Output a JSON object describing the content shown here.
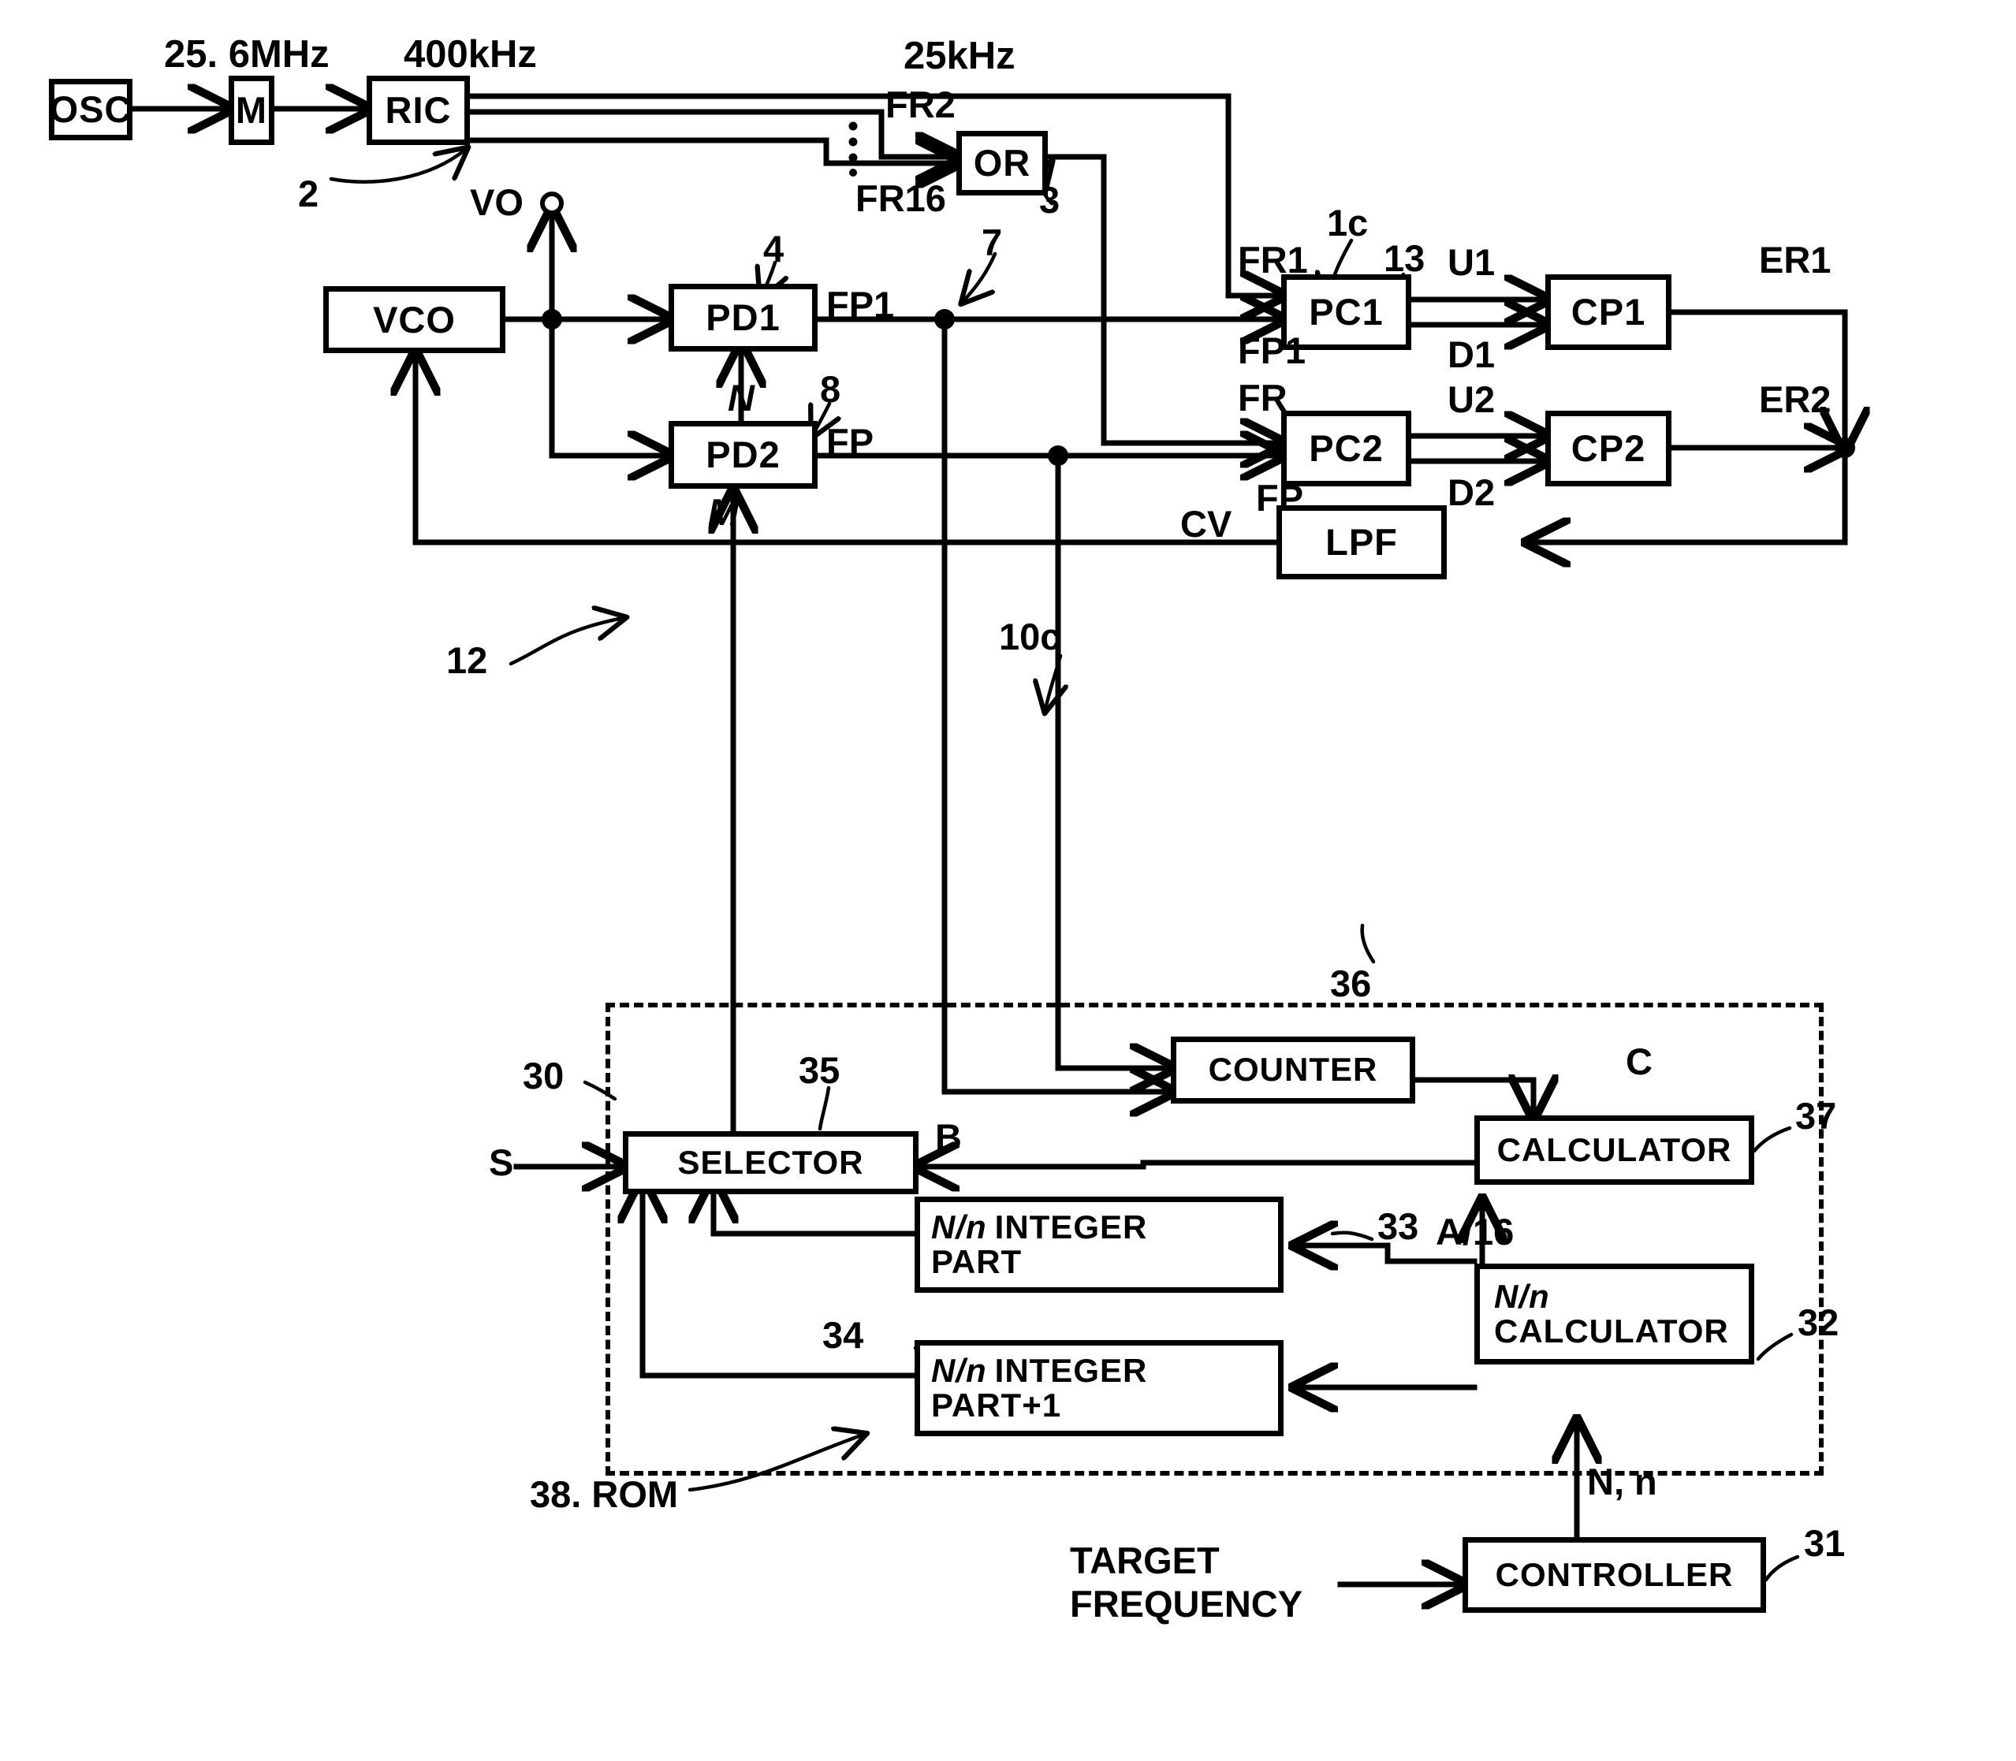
{
  "figure": {
    "type": "patent-block-diagram",
    "description": "PLL frequency synthesizer block diagram"
  },
  "blocks": {
    "osc": "OSC",
    "m_divider": "M",
    "ric": "RIC",
    "or_gate": "OR",
    "vco": "VCO",
    "pd1": "PD1",
    "pd2": "PD2",
    "pc1": "PC1",
    "pc2": "PC2",
    "cp1": "CP1",
    "cp2": "CP2",
    "lpf": "LPF",
    "counter": "COUNTER",
    "selector": "SELECTOR",
    "calculator": "CALCULATOR",
    "nn_calculator_l1": "N/n",
    "nn_calculator_l2": "CALCULATOR",
    "rom33_l1": "N/n",
    "rom33_l2": "INTEGER",
    "rom33_l3": "PART",
    "rom34_l1": "N/n",
    "rom34_l2": "INTEGER",
    "rom34_l3": "PART+1",
    "controller": "CONTROLLER"
  },
  "signal_labels": {
    "freq_25_6mhz": "25. 6MHz",
    "freq_400khz": "400kHz",
    "freq_25khz": "25kHz",
    "fr2": "FR2",
    "fr16": "FR16",
    "vo": "VO",
    "fp1_out": "FP1",
    "fp_out": "FP",
    "fr1": "FR1",
    "fp1_in": "FP1",
    "u1": "U1",
    "d1": "D1",
    "er1": "ER1",
    "fr": "FR",
    "fp": "FP",
    "u2": "U2",
    "d2": "D2",
    "er2": "ER2",
    "cv": "CV",
    "n_div": "N",
    "m_div": "M",
    "s_input": "S",
    "b_signal": "B",
    "c_signal": "C",
    "a_over_16": "A/16",
    "n_comma_n": "N, n",
    "target_frequency_l1": "TARGET",
    "target_frequency_l2": "FREQUENCY"
  },
  "reference_numbers": {
    "ref_2": "2",
    "ref_3": "3",
    "ref_4": "4",
    "ref_7": "7",
    "ref_8": "8",
    "ref_12": "12",
    "ref_13": "13",
    "ref_1c": "1c",
    "ref_10c": "10c",
    "ref_30": "30",
    "ref_31": "31",
    "ref_32": "32",
    "ref_33": "33",
    "ref_34": "34",
    "ref_35": "35",
    "ref_36": "36",
    "ref_37": "37",
    "ref_38_rom": "38. ROM"
  },
  "colors": {
    "ink": "#000000",
    "paper": "#ffffff"
  }
}
